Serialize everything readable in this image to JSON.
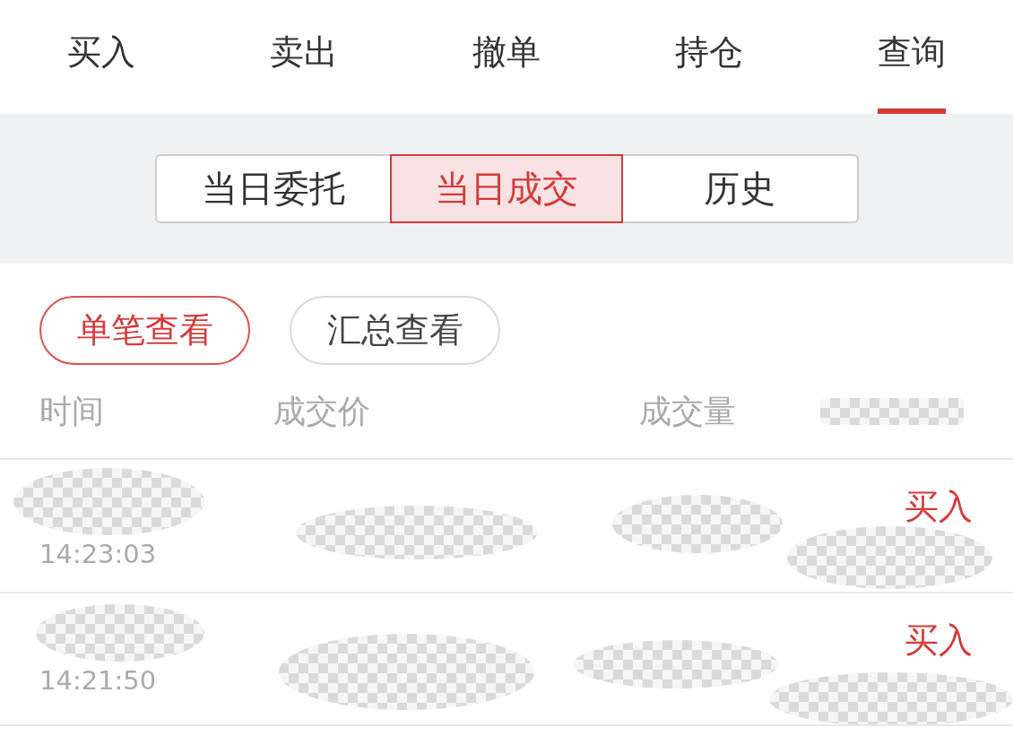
{
  "tabs": [
    {
      "label": "买入",
      "selected": false
    },
    {
      "label": "卖出",
      "selected": false
    },
    {
      "label": "撤单",
      "selected": false
    },
    {
      "label": "持仓",
      "selected": false
    },
    {
      "label": "查询",
      "selected": true
    }
  ],
  "segments": [
    {
      "label": "当日委托",
      "selected": false
    },
    {
      "label": "当日成交",
      "selected": true
    },
    {
      "label": "历史",
      "selected": false
    }
  ],
  "view_toggle": [
    {
      "label": "单笔查看",
      "selected": true
    },
    {
      "label": "汇总查看",
      "selected": false
    }
  ],
  "columns": [
    {
      "label": "时间"
    },
    {
      "label": "成交价"
    },
    {
      "label": "成交量"
    },
    {
      "redacted": true
    }
  ],
  "rows": [
    {
      "time": "14:23:03",
      "side": "买入",
      "redacted": true
    },
    {
      "time": "14:21:50",
      "side": "买入",
      "redacted": true
    }
  ]
}
